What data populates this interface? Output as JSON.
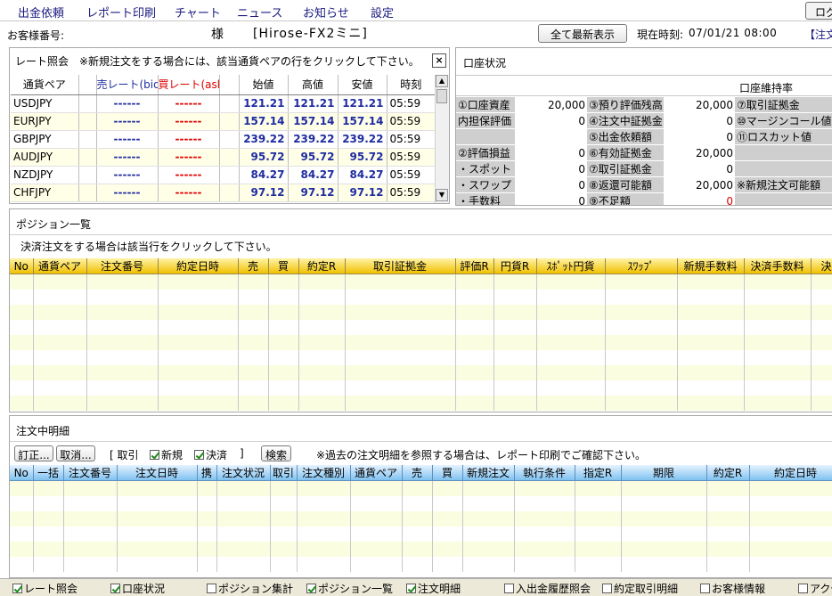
{
  "menu": {
    "items": [
      "出金依頼",
      "レポート印刷",
      "チャート",
      "ニュース",
      "お知らせ",
      "設定"
    ],
    "logout_label": "ログ"
  },
  "header": {
    "customer_label": "お客様番号:",
    "honorific": "様",
    "product": "[Hirose-FX2ミニ]",
    "refresh_button": "全て最新表示",
    "time_label": "現在時刻:",
    "time_value": "07/01/21 08:00",
    "order_link": "【注文"
  },
  "rate_panel": {
    "title": "レート照会",
    "notice": "※新規注文をする場合には、該当通貨ペアの行をクリックして下さい。",
    "close": "×",
    "columns": [
      "通貨ペア",
      "",
      "売レート(bid)",
      "買レート(ask)",
      "",
      "始値",
      "高値",
      "安値",
      "時刻"
    ],
    "rows": [
      {
        "pair": "USDJPY",
        "bid": "------",
        "ask": "------",
        "open": "121.21",
        "high": "121.21",
        "low": "121.21",
        "time": "05:59"
      },
      {
        "pair": "EURJPY",
        "bid": "------",
        "ask": "------",
        "open": "157.14",
        "high": "157.14",
        "low": "157.14",
        "time": "05:59"
      },
      {
        "pair": "GBPJPY",
        "bid": "------",
        "ask": "------",
        "open": "239.22",
        "high": "239.22",
        "low": "239.22",
        "time": "05:59"
      },
      {
        "pair": "AUDJPY",
        "bid": "------",
        "ask": "------",
        "open": "95.72",
        "high": "95.72",
        "low": "95.72",
        "time": "05:59"
      },
      {
        "pair": "NZDJPY",
        "bid": "------",
        "ask": "------",
        "open": "84.27",
        "high": "84.27",
        "low": "84.27",
        "time": "05:59"
      },
      {
        "pair": "CHFJPY",
        "bid": "------",
        "ask": "------",
        "open": "97.12",
        "high": "97.12",
        "low": "97.12",
        "time": "05:59"
      }
    ]
  },
  "account_panel": {
    "title": "口座状況",
    "maintenance_label": "口座維持率",
    "col1": [
      {
        "label": "①口座資産",
        "value": "20,000"
      },
      {
        "label": "内担保評価",
        "value": "0"
      },
      {
        "label": "",
        "value": ""
      },
      {
        "label": "②評価損益",
        "value": "0"
      },
      {
        "label": "・スポット",
        "value": "0"
      },
      {
        "label": "・スワップ",
        "value": "0"
      },
      {
        "label": "・手数料",
        "value": "0"
      }
    ],
    "col2": [
      {
        "label": "③預り評価残高",
        "value": "20,000"
      },
      {
        "label": "④注文中証拠金",
        "value": "0"
      },
      {
        "label": "⑤出金依頼額",
        "value": "0"
      },
      {
        "label": "⑥有効証拠金",
        "value": "20,000"
      },
      {
        "label": "⑦取引証拠金",
        "value": "0"
      },
      {
        "label": "⑧返還可能額",
        "value": "20,000"
      },
      {
        "label": "⑨不足額",
        "value": "0"
      }
    ],
    "col3": [
      {
        "label": "⑦取引証拠金"
      },
      {
        "label": "⑩マージンコール値"
      },
      {
        "label": "⑪ロスカット値"
      },
      {
        "label": ""
      },
      {
        "label": ""
      },
      {
        "label": "※新規注文可能額"
      },
      {
        "label": ""
      }
    ]
  },
  "position_panel": {
    "title": "ポジション一覧",
    "notice": "決済注文をする場合は該当行をクリックして下さい。",
    "columns": [
      "No",
      "通貨ペア",
      "注文番号",
      "約定日時",
      "売",
      "買",
      "約定R",
      "取引証拠金",
      "評価R",
      "円貨R",
      "ｽﾎﾟｯﾄ円貨",
      "ｽﾜｯﾌﾟ",
      "新規手数料",
      "決済手数料",
      "決"
    ]
  },
  "order_panel": {
    "title": "注文中明細",
    "buttons": {
      "correct": "訂正...",
      "cancel": "取消...",
      "search": "検索"
    },
    "filter_open": "[ 取引",
    "filter_new": "新規",
    "filter_settle": "決済",
    "filter_close": "]",
    "notice": "※過去の注文明細を参照する場合は、レポート印刷でご確認下さい。",
    "columns": [
      "No",
      "一括",
      "注文番号",
      "注文日時",
      "携",
      "注文状況",
      "取引",
      "注文種別",
      "通貨ペア",
      "売",
      "買",
      "新規注文",
      "執行条件",
      "指定R",
      "期限",
      "約定R",
      "約定日時"
    ]
  },
  "bottom": {
    "checks": [
      {
        "label": "レート照会",
        "on": true
      },
      {
        "label": "口座状況",
        "on": true
      },
      {
        "label": "ポジション集計",
        "on": false
      },
      {
        "label": "ポジション一覧",
        "on": true
      },
      {
        "label": "注文明細",
        "on": true
      },
      {
        "label": "入出金履歴照会",
        "on": false
      },
      {
        "label": "約定取引明細",
        "on": false
      },
      {
        "label": "お客様情報",
        "on": false
      },
      {
        "label": "アクセ",
        "on": false
      }
    ]
  },
  "colors": {
    "menu_text": "#1a1a80",
    "price_blue": "#1f2ca0",
    "ask_red": "#e00000",
    "header_yellow": "#f0c000",
    "header_blue": "#7fc1f0"
  }
}
